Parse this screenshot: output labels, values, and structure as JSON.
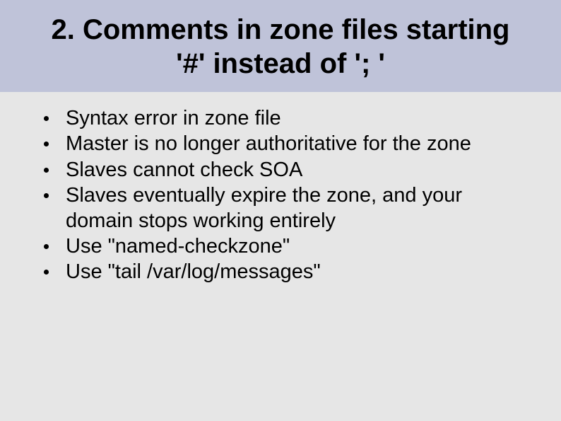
{
  "slide": {
    "title": "2. Comments in zone files starting '#' instead of '; '",
    "bullets": [
      "Syntax error in zone file",
      "Master is no longer authoritative for the zone",
      "Slaves cannot check SOA",
      "Slaves eventually expire the zone, and your domain stops working entirely",
      "Use \"named-checkzone\"",
      "Use \"tail /var/log/messages\""
    ]
  }
}
